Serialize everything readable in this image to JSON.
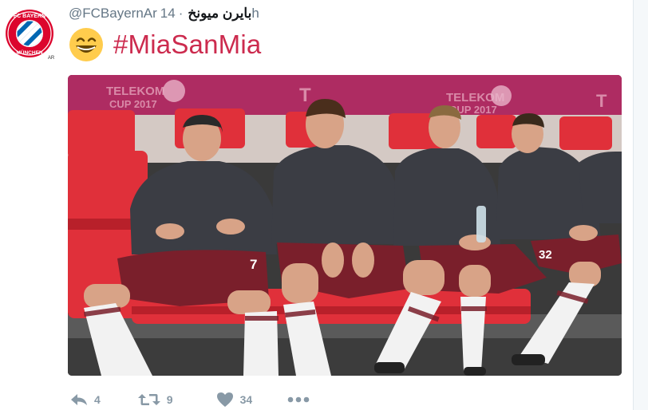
{
  "tweet": {
    "handle": "@FCBayernAr",
    "display_name": "بايرن ميونخ",
    "separator": "·",
    "time": "14h",
    "hashtag": "#MiaSanMia",
    "emoji": "grinning-face-emoji",
    "avatar_text": "FC BAYERN MÜNCHEN",
    "avatar_suffix": "AR"
  },
  "photo": {
    "description_icon": "team-bench-photo",
    "banner_text_1": "TELEKOM",
    "banner_text_2": "CUP 2017",
    "banner_text_3": "TELEKOM",
    "banner_text_4": "CUP 2017",
    "shirt_number_1": "7",
    "shirt_number_2": "32"
  },
  "actions": {
    "reply_count": "4",
    "retweet_count": "9",
    "like_count": "34",
    "more_icon": "more-icon"
  },
  "colors": {
    "hashtag": "#cc2b4e",
    "bayern_red": "#dc052d",
    "bayern_blue": "#0066b2",
    "action_grey": "#8899a6"
  }
}
